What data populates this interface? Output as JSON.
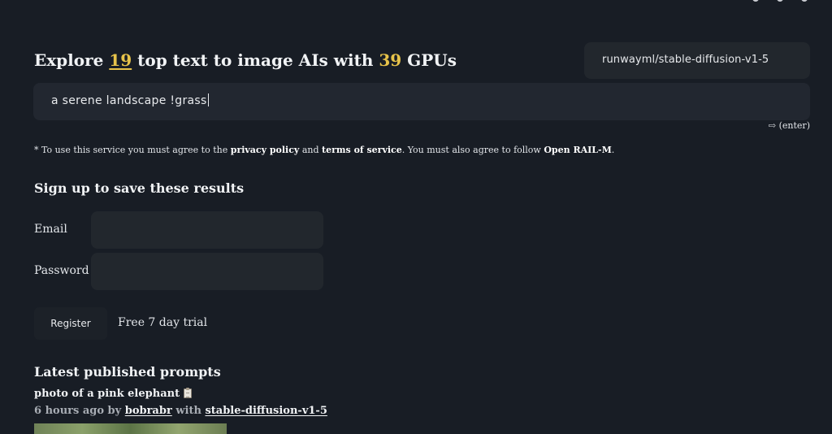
{
  "header": {
    "prefix": "Explore",
    "model_count": "19",
    "middle": "top text to image AIs with",
    "gpu_count": "39",
    "suffix": "GPUs"
  },
  "model_select": {
    "value": "runwayml/stable-diffusion-v1-5"
  },
  "prompt_input": {
    "value": "a serene landscape !grass"
  },
  "enter_hint": "⇨ (enter)",
  "terms": {
    "part1": "* To use this service you must agree to the",
    "privacy": "privacy policy",
    "and": "and",
    "tos": "terms of service",
    "part2": ". You must also agree to follow",
    "license": "Open RAIL-M",
    "end": "."
  },
  "signup": {
    "title": "Sign up to save these results",
    "email_label": "Email",
    "password_label": "Password",
    "register_label": "Register",
    "trial_text": "Free 7 day trial"
  },
  "latest": {
    "title": "Latest published prompts",
    "items": [
      {
        "prompt": "photo of a pink elephant",
        "time": "6 hours ago by",
        "user": "bobrabr",
        "with": "with",
        "model": "stable-diffusion-v1-5"
      }
    ]
  },
  "colors": {
    "background": "#181d25",
    "accent": "#e7c34a",
    "field": "#22272d"
  },
  "icons": [
    "clipboard-icon"
  ]
}
